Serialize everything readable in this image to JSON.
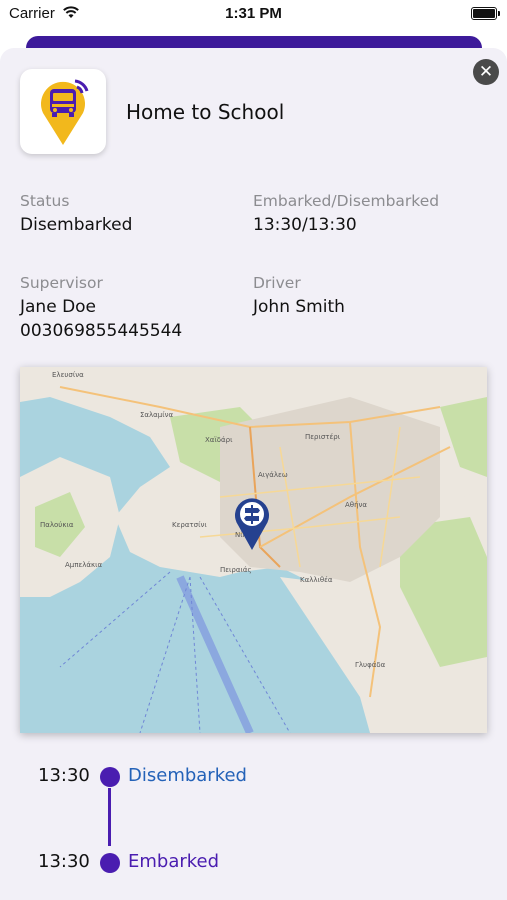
{
  "status_bar": {
    "carrier": "Carrier",
    "time": "1:31 PM"
  },
  "sheet": {
    "title": "Home to School",
    "close_icon": "close-icon",
    "app_icon": "bus-location-pin-icon",
    "fields": {
      "status_label": "Status",
      "status_value": "Disembarked",
      "times_label": "Embarked/Disembarked",
      "times_value": "13:30/13:30",
      "supervisor_label": "Supervisor",
      "supervisor_name": "Jane Doe",
      "supervisor_phone": "003069855445544",
      "driver_label": "Driver",
      "driver_name": "John Smith"
    },
    "map": {
      "marker_icon": "signpost-location-pin-icon",
      "place_labels": [
        "Ελευσίνα",
        "Σαλαμίνα",
        "Κερατσίνι",
        "Πειραιάς",
        "Αθήνα",
        "Περιστέρι",
        "Καλλιθέα",
        "Αιγάλεω",
        "Γλυφάδα",
        "Παλούκια",
        "Αμπελάκια",
        "Χαϊδάρι",
        "Νίκαια"
      ]
    }
  },
  "timeline": [
    {
      "time": "13:30",
      "label": "Disembarked"
    },
    {
      "time": "13:30",
      "label": "Embarked"
    }
  ],
  "colors": {
    "accent_purple": "#4a1db0",
    "link_blue": "#2462b8",
    "sheet_background": "#f2f0f7",
    "label_grey": "#8c8c90"
  }
}
